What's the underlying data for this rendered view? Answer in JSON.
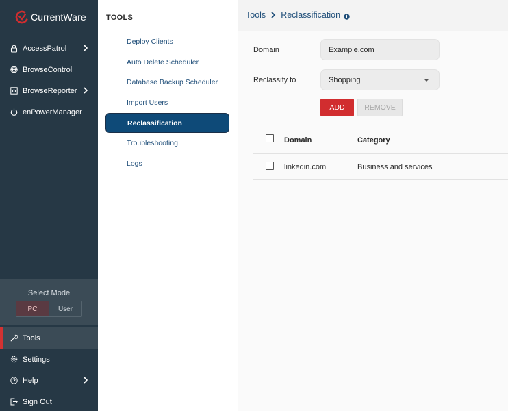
{
  "brand": {
    "name": "CurrentWare",
    "accent": "#d12d2f"
  },
  "sidebar": {
    "items": [
      {
        "label": "AccessPatrol",
        "icon": "lock-icon",
        "has_children": true
      },
      {
        "label": "BrowseControl",
        "icon": "globe-icon",
        "has_children": false
      },
      {
        "label": "BrowseReporter",
        "icon": "report-icon",
        "has_children": true
      },
      {
        "label": "enPowerManager",
        "icon": "power-icon",
        "has_children": false
      }
    ],
    "mode": {
      "title": "Select Mode",
      "options": [
        "PC",
        "User"
      ],
      "selected": "PC"
    },
    "bottom_items": [
      {
        "label": "Tools",
        "icon": "wrench-icon",
        "active": true
      },
      {
        "label": "Settings",
        "icon": "gear-icon"
      },
      {
        "label": "Help",
        "icon": "help-icon",
        "has_children": true
      },
      {
        "label": "Sign Out",
        "icon": "sign-out-icon"
      }
    ]
  },
  "tools": {
    "heading": "TOOLS",
    "items": [
      {
        "label": "Deploy Clients"
      },
      {
        "label": "Auto Delete Scheduler"
      },
      {
        "label": "Database Backup Scheduler"
      },
      {
        "label": "Import Users"
      },
      {
        "label": "Reclassification",
        "active": true
      },
      {
        "label": "Troubleshooting"
      },
      {
        "label": "Logs"
      }
    ]
  },
  "breadcrumb": {
    "root": "Tools",
    "current": "Reclassification"
  },
  "form": {
    "domain_label": "Domain",
    "domain_value": "Example.com",
    "reclassify_label": "Reclassify to",
    "reclassify_value": "Shopping",
    "add_label": "ADD",
    "remove_label": "REMOVE"
  },
  "table": {
    "headers": [
      "Domain",
      "Category"
    ],
    "rows": [
      {
        "domain": "linkedin.com",
        "category": "Business and services"
      }
    ]
  }
}
